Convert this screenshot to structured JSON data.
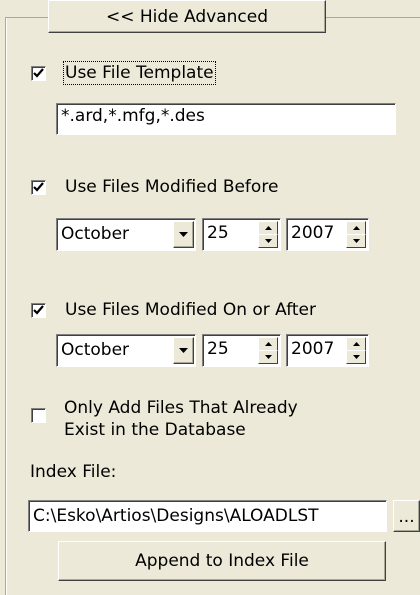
{
  "hide_advanced_label": "<< Hide Advanced",
  "use_file_template": {
    "label": "Use File Template",
    "checked": true,
    "value": "*.ard,*.mfg,*.des"
  },
  "modified_before": {
    "label": "Use Files Modified Before",
    "checked": true,
    "month": "October",
    "day": "25",
    "year": "2007"
  },
  "modified_after": {
    "label": "Use Files Modified On or After",
    "checked": true,
    "month": "October",
    "day": "25",
    "year": "2007"
  },
  "only_existing": {
    "label_line1": "Only Add Files That Already",
    "label_line2": "Exist in the Database",
    "checked": false
  },
  "index_file": {
    "label": "Index File:",
    "value": "C:\\Esko\\Artios\\Designs\\ALOADLST",
    "browse_label": "..."
  },
  "append_label": "Append to Index File",
  "icons": {
    "checkmark": "checkmark-icon",
    "dropdown": "chevron-down-icon",
    "spin_up": "spin-up-icon",
    "spin_down": "spin-down-icon"
  }
}
